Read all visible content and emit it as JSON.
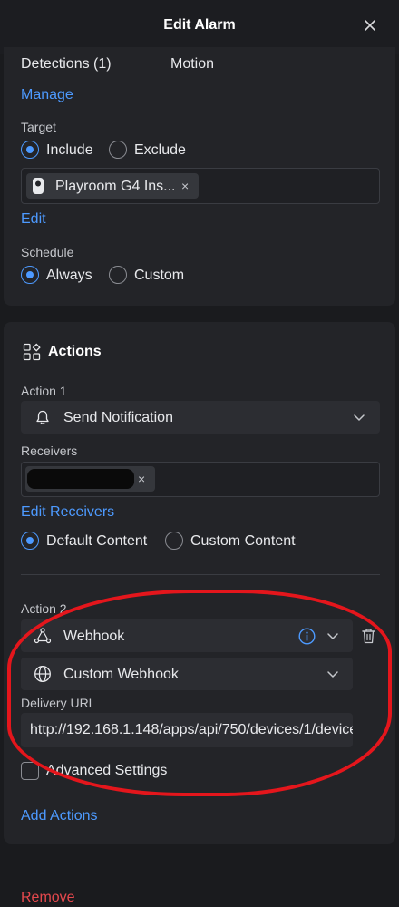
{
  "header": {
    "title": "Edit Alarm",
    "close_icon": "close-icon"
  },
  "trigger": {
    "detections_label": "Detections (1)",
    "detections_value": "Motion",
    "manage_link": "Manage"
  },
  "target": {
    "label": "Target",
    "options": [
      {
        "label": "Include",
        "selected": true
      },
      {
        "label": "Exclude",
        "selected": false
      }
    ],
    "chip_label": "Playroom G4 Ins...",
    "chip_remove": "×",
    "edit_link": "Edit"
  },
  "schedule": {
    "label": "Schedule",
    "options": [
      {
        "label": "Always",
        "selected": true
      },
      {
        "label": "Custom",
        "selected": false
      }
    ]
  },
  "actions": {
    "heading": "Actions",
    "action1": {
      "label": "Action 1",
      "type": "Send Notification",
      "receivers_label": "Receivers",
      "receiver_remove": "×",
      "edit_receivers_link": "Edit Receivers",
      "content_options": [
        {
          "label": "Default Content",
          "selected": true
        },
        {
          "label": "Custom Content",
          "selected": false
        }
      ]
    },
    "action2": {
      "label": "Action 2",
      "type": "Webhook",
      "webhook_kind": "Custom Webhook",
      "delivery_url_label": "Delivery URL",
      "delivery_url_value": "http://192.168.1.148/apps/api/750/devices/1/device",
      "advanced_settings_label": "Advanced Settings"
    },
    "add_actions_link": "Add Actions"
  },
  "footer": {
    "remove_link": "Remove"
  },
  "colors": {
    "accent": "#4d9aff",
    "danger": "#e5484d",
    "annotation": "#e4161c",
    "background": "#1a1b1e",
    "card": "#232428"
  }
}
